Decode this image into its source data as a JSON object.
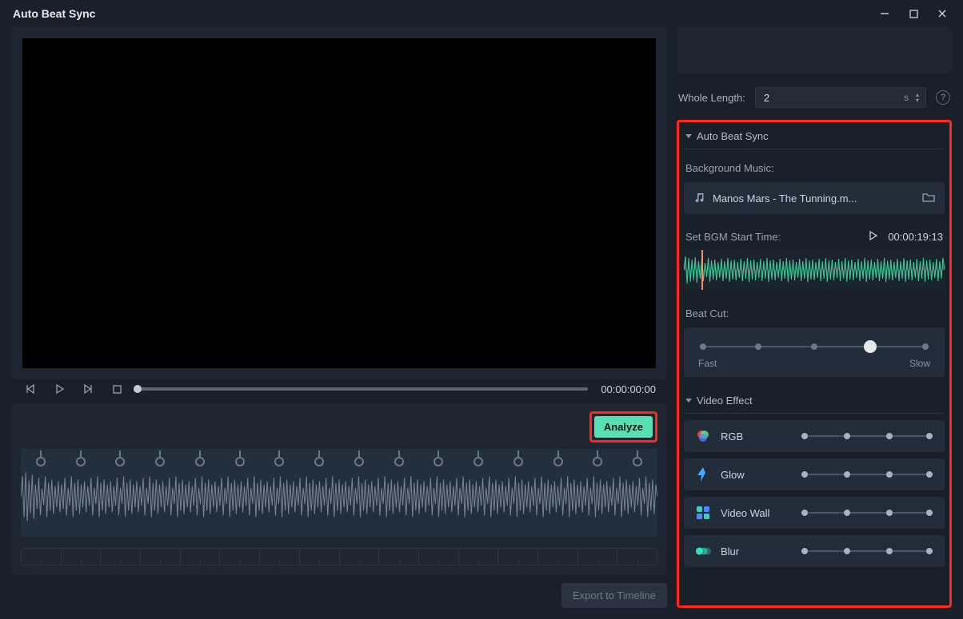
{
  "window": {
    "title": "Auto Beat Sync"
  },
  "transport": {
    "timecode": "00:00:00:00"
  },
  "analyze": {
    "button": "Analyze"
  },
  "export": {
    "button": "Export to Timeline"
  },
  "right": {
    "whole_length_label": "Whole Length:",
    "whole_length_value": "2",
    "whole_length_unit": "s"
  },
  "abs": {
    "header": "Auto Beat Sync",
    "bgm_label": "Background Music:",
    "music_name": "Manos Mars - The Tunning.m...",
    "bgm_start_label": "Set BGM Start Time:",
    "bgm_start_time": "00:00:19:13",
    "beat_cut_label": "Beat Cut:",
    "beat_fast": "Fast",
    "beat_slow": "Slow"
  },
  "video_effect": {
    "header": "Video Effect",
    "effects": [
      {
        "name": "RGB"
      },
      {
        "name": "Glow"
      },
      {
        "name": "Video Wall"
      },
      {
        "name": "Blur"
      }
    ]
  }
}
